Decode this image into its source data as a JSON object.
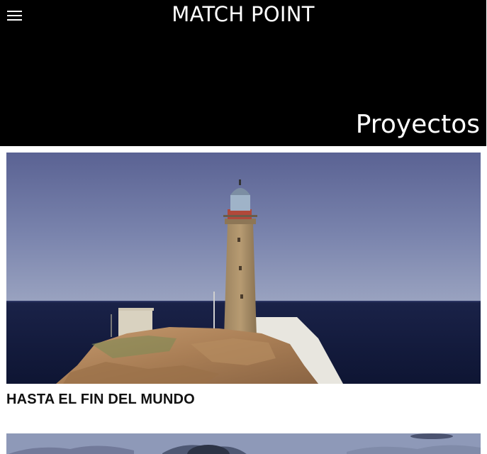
{
  "header": {
    "site_title": "MATCH POINT",
    "section_title": "Proyectos",
    "menu_icon": "hamburger-menu-icon"
  },
  "projects": [
    {
      "title": "HASTA EL FIN DEL MUNDO",
      "image": "lighthouse-on-cliff-photo"
    },
    {
      "title": "",
      "image": "sky-with-tree-photo"
    }
  ],
  "colors": {
    "header_bg": "#000000",
    "header_text": "#ffffff",
    "card_title": "#111111"
  }
}
